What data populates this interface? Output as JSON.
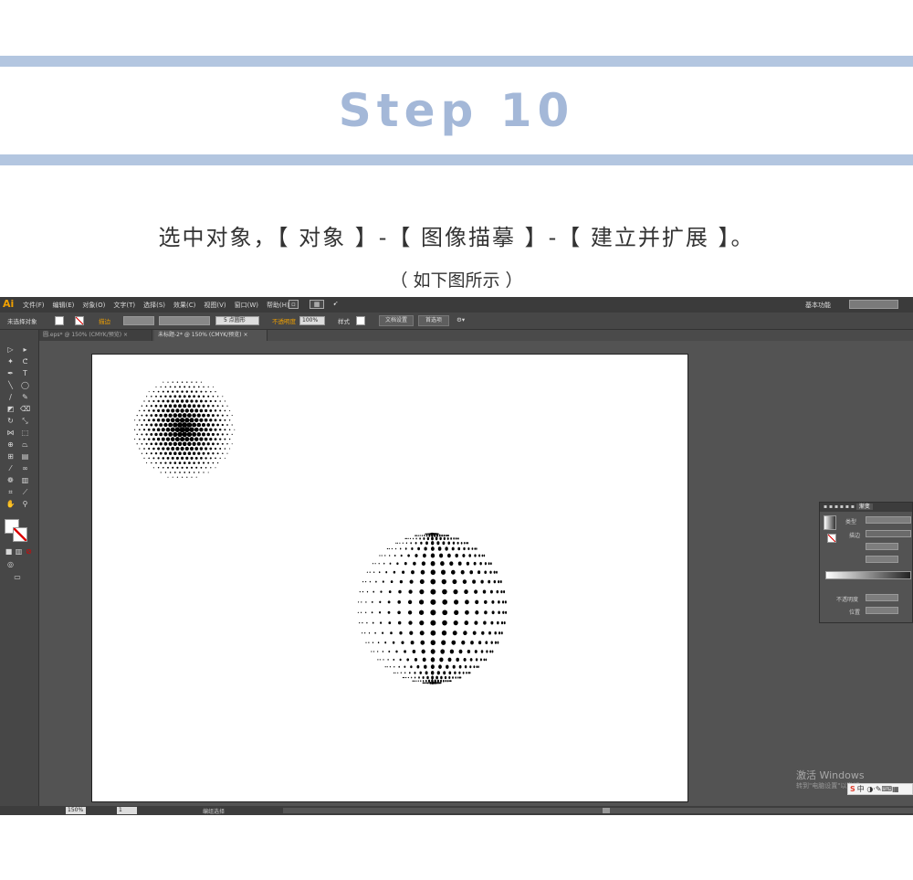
{
  "header": {
    "step_title": "Step 10",
    "instruction": "选中对象，【 对象 】-【 图像描摹 】-【 建立并扩展 】。",
    "sub_instruction": "（ 如下图所示 ）",
    "accent_color": "#b3c6e0",
    "title_color": "#a4b8d8"
  },
  "app": {
    "name": "Illustrator",
    "logo": "Ai",
    "menu": [
      "文件(F)",
      "编辑(E)",
      "对象(O)",
      "文字(T)",
      "选择(S)",
      "效果(C)",
      "视图(V)",
      "窗口(W)",
      "帮助(H)"
    ],
    "workspace_label": "基本功能",
    "control_bar": {
      "selection_label": "未选择对象",
      "stroke_label": "描边",
      "brush_label": "5 点圆形",
      "opacity_label": "不透明度",
      "opacity_value": "100%",
      "style_label": "样式",
      "doc_setup_button": "文档设置",
      "prefs_button": "首选项"
    },
    "tabs": [
      {
        "label": "圆.eps* @ 150% (CMYK/预览)",
        "active": false
      },
      {
        "label": "未标题-2* @ 150% (CMYK/预览)",
        "active": true
      }
    ],
    "gradient_panel": {
      "tab_label": "渐变",
      "type_label": "类型",
      "stroke_label": "描边",
      "opacity_label": "不透明度",
      "position_label": "位置"
    },
    "status": {
      "zoom": "150%",
      "page": "1",
      "mode": "编组选择"
    },
    "watermark": {
      "title": "激活 Windows",
      "subtitle": "转到\"电脑设置\"以激活"
    },
    "ime": {
      "logo": "S",
      "label": "中"
    }
  }
}
